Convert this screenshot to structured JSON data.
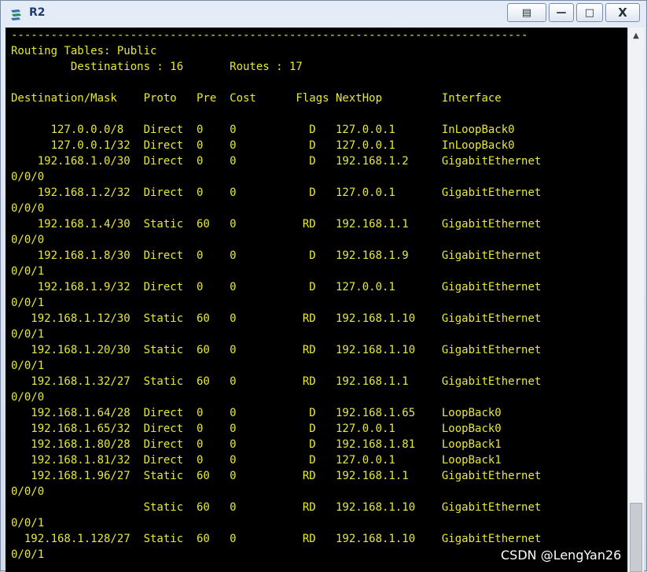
{
  "window": {
    "title": "R2",
    "buttons": {
      "custom": "▤",
      "minimize": "—",
      "maximize": "□",
      "close": "X"
    }
  },
  "colors": {
    "terminal_bg": "#000000",
    "terminal_text": "#e8e838",
    "title_text": "#1e3a6e"
  },
  "terminal": {
    "lines": [
      "------------------------------------------------------------------------------",
      "Routing Tables: Public",
      "         Destinations : 16       Routes : 17",
      "",
      "Destination/Mask    Proto   Pre  Cost      Flags NextHop         Interface",
      "",
      "      127.0.0.0/8   Direct  0    0           D   127.0.0.1       InLoopBack0",
      "      127.0.0.1/32  Direct  0    0           D   127.0.0.1       InLoopBack0",
      "    192.168.1.0/30  Direct  0    0           D   192.168.1.2     GigabitEthernet",
      "0/0/0",
      "    192.168.1.2/32  Direct  0    0           D   127.0.0.1       GigabitEthernet",
      "0/0/0",
      "    192.168.1.4/30  Static  60   0          RD   192.168.1.1     GigabitEthernet",
      "0/0/0",
      "    192.168.1.8/30  Direct  0    0           D   192.168.1.9     GigabitEthernet",
      "0/0/1",
      "    192.168.1.9/32  Direct  0    0           D   127.0.0.1       GigabitEthernet",
      "0/0/1",
      "   192.168.1.12/30  Static  60   0          RD   192.168.1.10    GigabitEthernet",
      "0/0/1",
      "   192.168.1.20/30  Static  60   0          RD   192.168.1.10    GigabitEthernet",
      "0/0/1",
      "   192.168.1.32/27  Static  60   0          RD   192.168.1.1     GigabitEthernet",
      "0/0/0",
      "   192.168.1.64/28  Direct  0    0           D   192.168.1.65    LoopBack0",
      "   192.168.1.65/32  Direct  0    0           D   127.0.0.1       LoopBack0",
      "   192.168.1.80/28  Direct  0    0           D   192.168.1.81    LoopBack1",
      "   192.168.1.81/32  Direct  0    0           D   127.0.0.1       LoopBack1",
      "   192.168.1.96/27  Static  60   0          RD   192.168.1.1     GigabitEthernet",
      "0/0/0",
      "                    Static  60   0          RD   192.168.1.10    GigabitEthernet",
      "0/0/1",
      "  192.168.1.128/27  Static  60   0          RD   192.168.1.10    GigabitEthernet",
      "0/0/1"
    ]
  },
  "watermark": "CSDN @LengYan26"
}
